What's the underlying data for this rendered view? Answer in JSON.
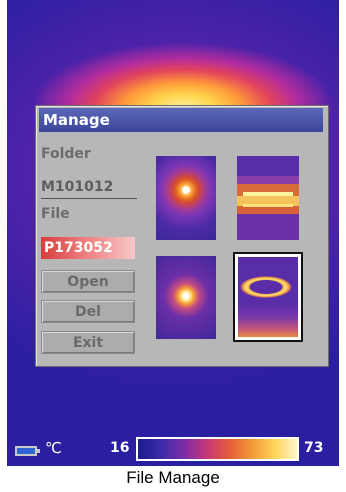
{
  "dialog": {
    "title": "Manage",
    "folder_label": "Folder",
    "folder_value": "M101012",
    "file_label": "File",
    "file_value": "P173052",
    "buttons": {
      "open": "Open",
      "del": "Del",
      "exit": "Exit"
    },
    "thumbnails": [
      "thermal-image-1",
      "thermal-image-2",
      "thermal-image-3",
      "thermal-image-4 (selected)"
    ]
  },
  "status_bar": {
    "battery_icon": "battery-icon",
    "unit": "℃",
    "temp_min": "16",
    "temp_max": "73"
  },
  "caption": "File Manage"
}
